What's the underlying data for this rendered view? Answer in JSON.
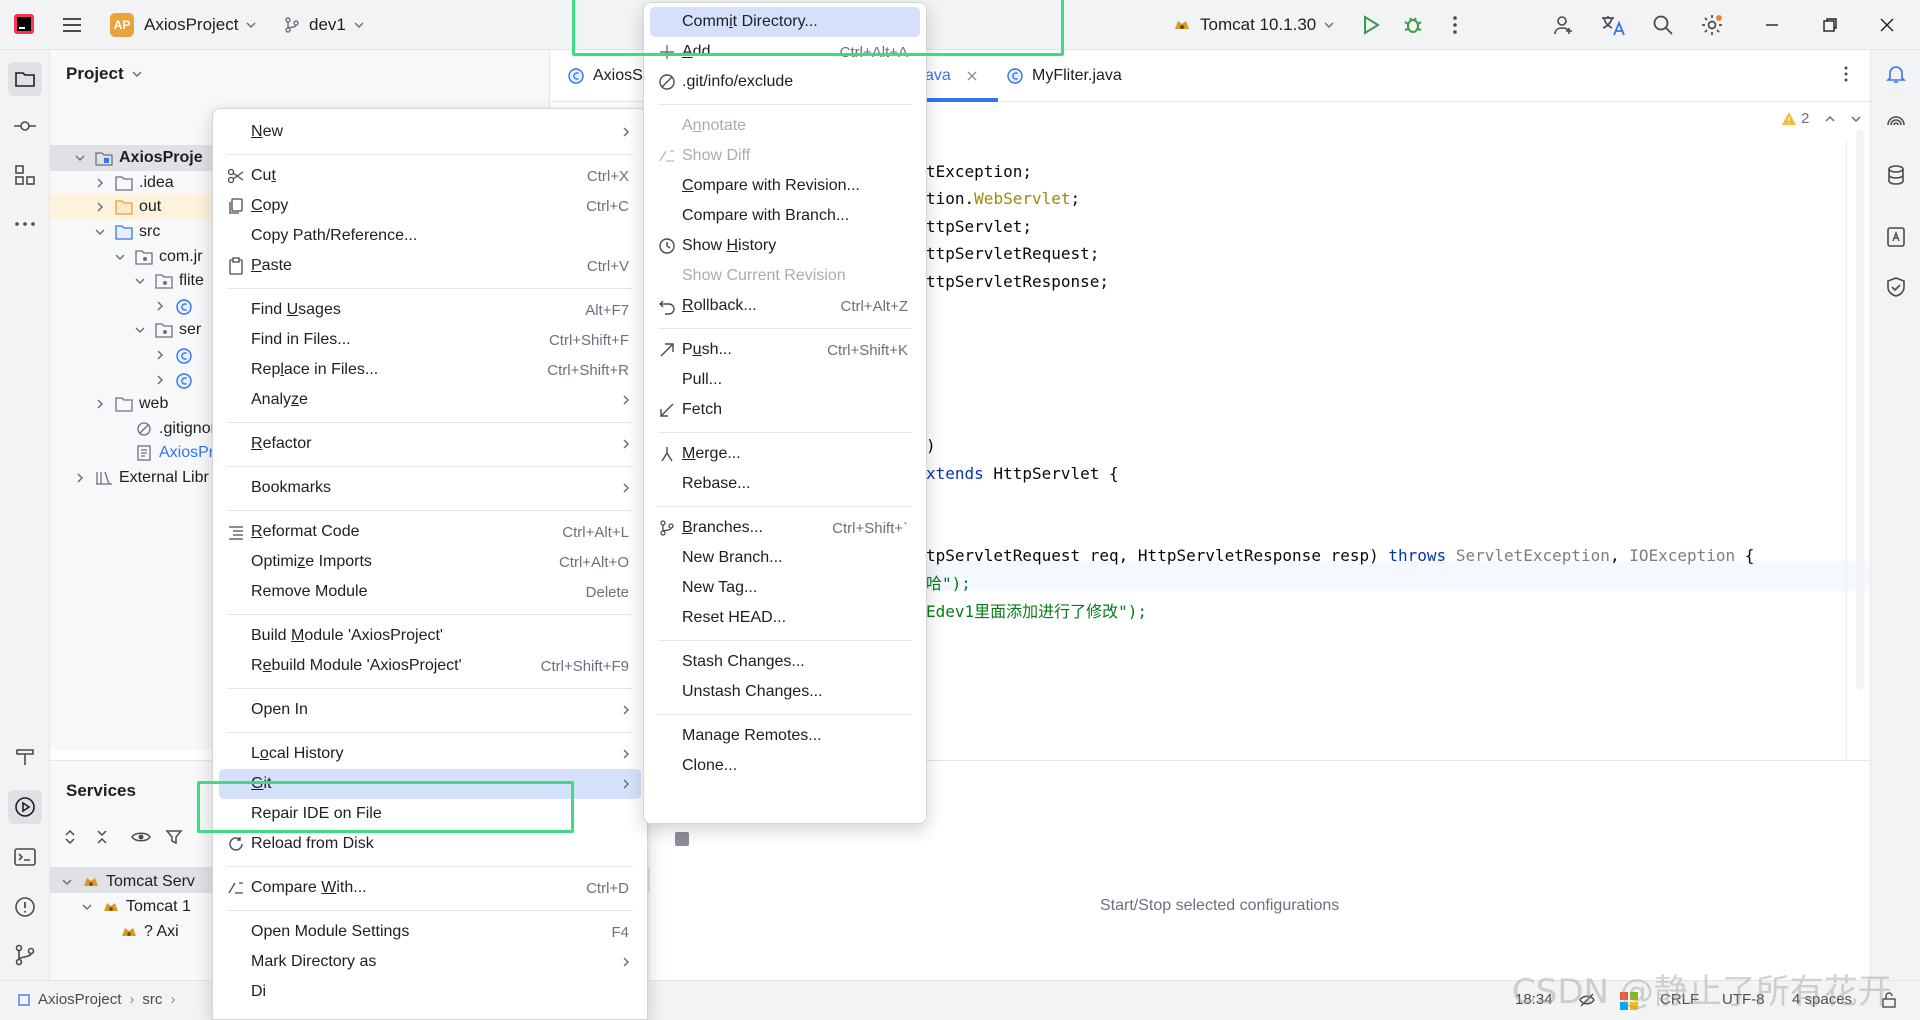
{
  "titlebar": {
    "project_badge": "AP",
    "project_name": "AxiosProject",
    "branch": "dev1",
    "run_config": "Tomcat 10.1.30"
  },
  "project_panel": {
    "title": "Project",
    "tree": [
      {
        "label": "AxiosProje",
        "bold": true
      },
      {
        "label": ".idea"
      },
      {
        "label": "out"
      },
      {
        "label": "src"
      },
      {
        "label": "com.jr"
      },
      {
        "label": "flite"
      },
      {
        "label": ""
      },
      {
        "label": "ser"
      },
      {
        "label": ""
      },
      {
        "label": ""
      },
      {
        "label": "web"
      },
      {
        "label": ".gitignore"
      },
      {
        "label": "AxiosProj"
      },
      {
        "label": "External Libr"
      }
    ]
  },
  "services": {
    "title": "Services",
    "tree": [
      {
        "label": "Tomcat Serv"
      },
      {
        "label": "Tomcat 1"
      },
      {
        "label": "? Axi"
      }
    ]
  },
  "editor": {
    "tabs": [
      {
        "label": "AxiosS"
      },
      {
        "label": "ava"
      },
      {
        "label": "MyFliter.java"
      }
    ],
    "warnings": "2",
    "code": [
      {
        "text": "tException;"
      },
      {
        "text": "tion.WebServlet;"
      },
      {
        "text": "ttpServlet;"
      },
      {
        "text": "ttpServletRequest;"
      },
      {
        "text": "ttpServletResponse;"
      },
      {
        "text": ")"
      },
      {
        "text": "xtends HttpServlet {"
      },
      {
        "text": "tpServletRequest req, HttpServletResponse resp) throws ServletException, IOException {"
      },
      {
        "text": "哈\");"
      },
      {
        "text": "Edev1里面添加进行了修改\");"
      }
    ]
  },
  "run_panel": {
    "hint": "Start/Stop selected configurations"
  },
  "statusbar": {
    "breadcrumb": [
      "AxiosProject",
      "src"
    ],
    "position": "18:34",
    "line_sep": "CRLF",
    "encoding": "UTF-8",
    "indent": "4 spaces"
  },
  "watermark": "CSDN @静止了所有花开",
  "context_menu": [
    {
      "label": "New",
      "sub": true,
      "u": 0
    },
    {
      "sep": true
    },
    {
      "label": "Cut",
      "shortcut": "Ctrl+X",
      "icon": "scissors-icon",
      "u": 2
    },
    {
      "label": "Copy",
      "shortcut": "Ctrl+C",
      "icon": "copy-icon",
      "u": 0
    },
    {
      "label": "Copy Path/Reference..."
    },
    {
      "label": "Paste",
      "shortcut": "Ctrl+V",
      "icon": "paste-icon",
      "u": 0
    },
    {
      "sep": true
    },
    {
      "label": "Find Usages",
      "shortcut": "Alt+F7",
      "u": 5
    },
    {
      "label": "Find in Files...",
      "shortcut": "Ctrl+Shift+F"
    },
    {
      "label": "Replace in Files...",
      "shortcut": "Ctrl+Shift+R",
      "u": 3
    },
    {
      "label": "Analyze",
      "sub": true,
      "u": 5
    },
    {
      "sep": true
    },
    {
      "label": "Refactor",
      "sub": true,
      "u": 0
    },
    {
      "sep": true
    },
    {
      "label": "Bookmarks",
      "sub": true
    },
    {
      "sep": true
    },
    {
      "label": "Reformat Code",
      "shortcut": "Ctrl+Alt+L",
      "icon": "reformat-icon",
      "u": 0
    },
    {
      "label": "Optimize Imports",
      "shortcut": "Ctrl+Alt+O",
      "u": 6
    },
    {
      "label": "Remove Module",
      "shortcut": "Delete"
    },
    {
      "sep": true
    },
    {
      "label": "Build Module 'AxiosProject'",
      "u": 6
    },
    {
      "label": "Rebuild Module 'AxiosProject'",
      "shortcut": "Ctrl+Shift+F9",
      "u": 1
    },
    {
      "sep": true
    },
    {
      "label": "Open In",
      "sub": true
    },
    {
      "sep": true
    },
    {
      "label": "Local History",
      "sub": true,
      "u": 1
    },
    {
      "label": "Git",
      "sub": true,
      "selected": true,
      "u": 0
    },
    {
      "label": "Repair IDE on File"
    },
    {
      "label": "Reload from Disk",
      "icon": "reload-icon"
    },
    {
      "sep": true
    },
    {
      "label": "Compare With...",
      "shortcut": "Ctrl+D",
      "icon": "compare-icon",
      "u": 8
    },
    {
      "sep": true
    },
    {
      "label": "Open Module Settings",
      "shortcut": "F4"
    },
    {
      "label": "Mark Directory as",
      "sub": true
    },
    {
      "label": "Di"
    }
  ],
  "git_menu": [
    {
      "label": "Commit Directory...",
      "selected": true,
      "u": 4
    },
    {
      "label": "Add",
      "shortcut": "Ctrl+Alt+A",
      "icon": "plus-icon",
      "u": 0
    },
    {
      "label": ".git/info/exclude",
      "icon": "ignore-icon"
    },
    {
      "sep": true
    },
    {
      "label": "Annotate",
      "disabled": true,
      "u": 1
    },
    {
      "label": "Show Diff",
      "disabled": true,
      "icon": "diff-icon"
    },
    {
      "label": "Compare with Revision...",
      "u": 0
    },
    {
      "label": "Compare with Branch..."
    },
    {
      "label": "Show History",
      "icon": "history-icon",
      "u": 5
    },
    {
      "label": "Show Current Revision",
      "disabled": true
    },
    {
      "label": "Rollback...",
      "shortcut": "Ctrl+Alt+Z",
      "icon": "rollback-icon",
      "u": 0
    },
    {
      "sep": true
    },
    {
      "label": "Push...",
      "shortcut": "Ctrl+Shift+K",
      "icon": "push-icon",
      "u": 1
    },
    {
      "label": "Pull..."
    },
    {
      "label": "Fetch",
      "icon": "fetch-icon"
    },
    {
      "sep": true
    },
    {
      "label": "Merge...",
      "icon": "merge-icon",
      "u": 0
    },
    {
      "label": "Rebase..."
    },
    {
      "sep": true
    },
    {
      "label": "Branches...",
      "shortcut": "Ctrl+Shift+`",
      "icon": "branch-icon",
      "u": 0
    },
    {
      "label": "New Branch..."
    },
    {
      "label": "New Tag..."
    },
    {
      "label": "Reset HEAD..."
    },
    {
      "sep": true
    },
    {
      "label": "Stash Changes..."
    },
    {
      "label": "Unstash Changes..."
    },
    {
      "sep": true
    },
    {
      "label": "Manage Remotes..."
    },
    {
      "label": "Clone..."
    }
  ],
  "colors": {
    "accent": "#3574f0",
    "selection": "#d5e1fb",
    "highlight_box": "#3ddc84",
    "keyword": "#0033b3",
    "string": "#067d17",
    "annotation": "#9e880d"
  }
}
